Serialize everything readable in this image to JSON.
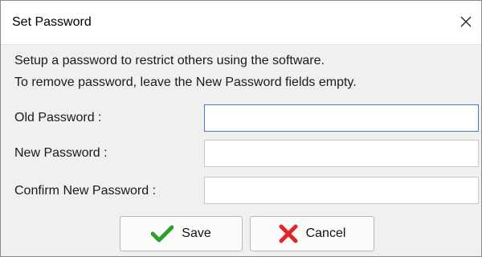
{
  "window": {
    "title": "Set Password",
    "close_icon": "close-icon"
  },
  "description": {
    "line1": "Setup a password to restrict others using the software.",
    "line2": "To remove password, leave the New Password fields empty."
  },
  "form": {
    "old_password_label": "Old Password :",
    "old_password_value": "",
    "new_password_label": "New Password :",
    "new_password_value": "",
    "confirm_password_label": "Confirm New Password :",
    "confirm_password_value": ""
  },
  "buttons": {
    "save_label": "Save",
    "save_icon": "checkmark-icon",
    "cancel_label": "Cancel",
    "cancel_icon": "red-x-icon"
  },
  "colors": {
    "save_icon": "#2aa12a",
    "cancel_icon": "#e0262b",
    "focus_border": "#3c7fd1"
  }
}
